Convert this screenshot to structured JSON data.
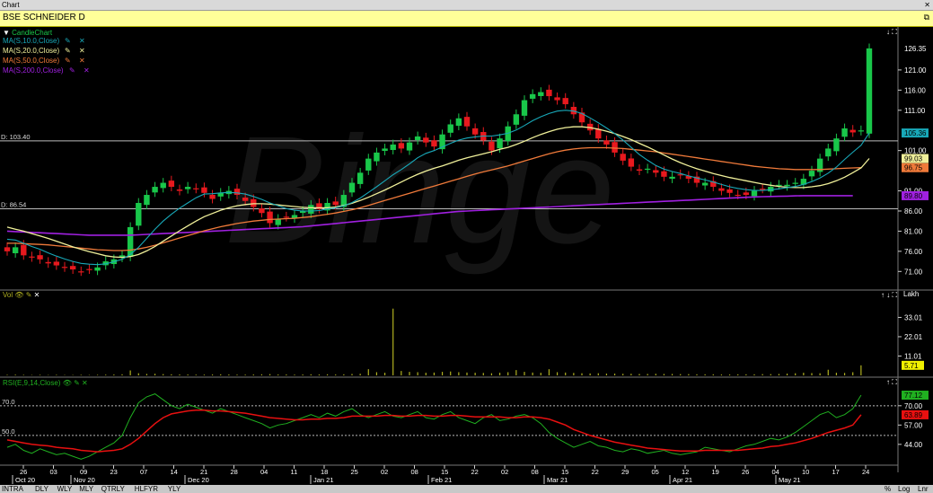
{
  "window": {
    "title": "Chart",
    "close_icon": "close-icon"
  },
  "symbol": {
    "name": "BSE SCHNEIDER D",
    "pin_icon": "pin-icon"
  },
  "colors": {
    "up": "#19c74a",
    "down": "#e8191e",
    "ma10": "#18a8b8",
    "ma20": "#f0f09a",
    "ma50": "#f07a3a",
    "ma200": "#a020e0",
    "volume": "#b0b020",
    "rsi": "#20b020",
    "rsi_avg": "#e81010"
  },
  "legend": {
    "candle": "CandleChart",
    "ma10": "MA(S,10.0,Close)",
    "ma20": "MA(S,20.0,Close)",
    "ma50": "MA(S,50.0,Close)",
    "ma200": "MA(S,200.0,Close)"
  },
  "ref_lines": [
    {
      "label": "D: 103.40",
      "value": 103.4
    },
    {
      "label": "D: 86.54",
      "value": 86.54
    }
  ],
  "price_ticks": [
    "126.35",
    "121.00",
    "116.00",
    "111.00",
    "105.36",
    "101.00",
    "99.03",
    "96.75",
    "91.00",
    "89.80",
    "86.00",
    "81.00",
    "76.00",
    "71.00"
  ],
  "price_badges": [
    {
      "text": "126.35",
      "value": 126.35,
      "bg": "#000000",
      "fg": "#ffffff"
    },
    {
      "text": "105.36",
      "value": 105.36,
      "bg": "#18a8b8",
      "fg": "#000000"
    },
    {
      "text": "99.03",
      "value": 99.03,
      "bg": "#f0f09a",
      "fg": "#000000"
    },
    {
      "text": "96.75",
      "value": 96.75,
      "bg": "#f07a3a",
      "fg": "#000000"
    },
    {
      "text": "89.80",
      "value": 89.8,
      "bg": "#a020e0",
      "fg": "#000000"
    }
  ],
  "volume_panel": {
    "label": "Vol",
    "unit": "Lakh",
    "ticks": [
      "33.01",
      "22.01",
      "11.01"
    ],
    "last": "5.71"
  },
  "rsi_panel": {
    "label": "RSI(E,9,14,Close)",
    "ticks": [
      "70.00",
      "57.00",
      "44.00"
    ],
    "left_ticks": [
      "70.0",
      "50.0"
    ],
    "last": "77.12",
    "avg": "63.89"
  },
  "x_labels": [
    "26",
    "03",
    "09",
    "23",
    "07",
    "14",
    "21",
    "28",
    "04",
    "11",
    "18",
    "25",
    "02",
    "08",
    "15",
    "22",
    "02",
    "08",
    "15",
    "22",
    "29",
    "05",
    "12",
    "19",
    "26",
    "04",
    "10",
    "17",
    "24"
  ],
  "x_months": [
    "Oct 20",
    "Nov 20",
    "Dec 20",
    "Jan 21",
    "Feb 21",
    "Mar 21",
    "Apr 21",
    "May 21"
  ],
  "bottom_tabs": [
    "INTRA",
    "DLY",
    "WLY",
    "MLY",
    "QTRLY",
    "HLFYR",
    "YLY"
  ],
  "bottom_right": [
    "%",
    "Log",
    "Lnr"
  ],
  "watermark": "Binge",
  "chart_data": {
    "type": "candlestick",
    "title": "BSE SCHNEIDER D",
    "y_range": [
      67.5,
      129
    ],
    "closes": [
      76,
      77,
      75,
      74.5,
      74,
      73,
      72.5,
      72,
      71.5,
      71,
      71.5,
      72,
      73.5,
      74,
      75,
      82,
      88,
      90,
      92,
      93,
      92,
      91,
      92,
      91.5,
      90.5,
      89,
      90.5,
      91,
      90,
      88.5,
      87,
      85.5,
      83,
      84,
      84.5,
      85,
      86,
      87.5,
      86.5,
      88,
      87.5,
      90,
      93,
      95.5,
      99,
      100.5,
      101.5,
      102.5,
      101.5,
      103,
      104.5,
      103,
      102,
      105,
      107.5,
      109,
      107,
      105,
      103.5,
      101,
      104,
      107,
      110,
      113.5,
      115,
      115.5,
      114.5,
      113.5,
      112.5,
      110,
      108,
      106,
      104,
      102.5,
      100.5,
      98.5,
      97,
      96,
      96.5,
      95.5,
      94.5,
      94.5,
      95,
      94,
      93,
      93,
      92,
      91,
      90.5,
      90,
      90,
      91,
      91.5,
      92,
      92.5,
      92.5,
      93,
      94,
      96,
      99,
      101.5,
      104,
      106.5,
      105.5,
      106,
      126.35
    ],
    "ma10": [
      79,
      78.8,
      78,
      77.2,
      76.5,
      75.6,
      74.8,
      74.1,
      73.5,
      73,
      72.8,
      72.7,
      72.9,
      73.4,
      74,
      75.2,
      77,
      79.2,
      81.5,
      83.5,
      85.2,
      86.7,
      88,
      89.3,
      90.2,
      90.3,
      90.5,
      90.6,
      90.5,
      90.2,
      89.6,
      88.9,
      88,
      87.3,
      86.6,
      86.2,
      86,
      86,
      86.1,
      86.5,
      86.8,
      87.3,
      88.1,
      89.2,
      90.6,
      92,
      93.5,
      95,
      96.3,
      97.7,
      99.2,
      100.3,
      101,
      101.9,
      102.8,
      103.6,
      104.1,
      104.4,
      104.6,
      104.6,
      104.9,
      105.3,
      106.1,
      107.2,
      108.4,
      109.4,
      110.2,
      110.8,
      111,
      110.8,
      110.2,
      109.1,
      107.9,
      106.6,
      105.2,
      103.6,
      101.8,
      100,
      98.6,
      97.3,
      96.4,
      95.8,
      95.3,
      94.7,
      94.2,
      93.7,
      93.2,
      92.6,
      92,
      91.6,
      91.3,
      91.1,
      91.1,
      91.3,
      91.5,
      91.8,
      92.1,
      92.6,
      93.3,
      94.2,
      95.4,
      96.9,
      98.8,
      100.6,
      102.3,
      105.36
    ],
    "ma20": [
      82,
      81.5,
      81,
      80.4,
      79.8,
      79.2,
      78.5,
      77.8,
      77.1,
      76.5,
      75.9,
      75.4,
      74.9,
      74.6,
      74.5,
      74.7,
      75.2,
      76.1,
      77.2,
      78.5,
      79.8,
      81.1,
      82.3,
      83.5,
      84.6,
      85.4,
      86.2,
      86.8,
      87.3,
      87.6,
      87.8,
      87.8,
      87.7,
      87.5,
      87.3,
      87.1,
      86.9,
      86.8,
      86.8,
      86.8,
      87,
      87.4,
      87.9,
      88.6,
      89.4,
      90.3,
      91.2,
      92.2,
      93.2,
      94.2,
      95.1,
      95.9,
      96.6,
      97.2,
      97.9,
      98.6,
      99.2,
      99.7,
      100.2,
      100.7,
      101.3,
      101.8,
      102.5,
      103.3,
      104.2,
      105,
      105.7,
      106.3,
      106.7,
      106.9,
      106.9,
      106.7,
      106.3,
      105.8,
      105.2,
      104.5,
      103.7,
      102.8,
      101.9,
      100.9,
      99.9,
      98.9,
      98,
      97.2,
      96.5,
      95.9,
      95.3,
      94.8,
      94.3,
      93.9,
      93.5,
      93.1,
      92.7,
      92.4,
      92.1,
      91.9,
      91.8,
      91.8,
      92,
      92.3,
      92.8,
      93.5,
      94.4,
      95.5,
      96.7,
      99.03
    ],
    "ma50": [
      78,
      78,
      77.9,
      77.8,
      77.7,
      77.6,
      77.4,
      77.2,
      77,
      76.8,
      76.6,
      76.4,
      76.3,
      76.2,
      76.2,
      76.3,
      76.6,
      77,
      77.5,
      78.1,
      78.7,
      79.3,
      79.9,
      80.5,
      81.1,
      81.6,
      82.1,
      82.5,
      82.9,
      83.2,
      83.5,
      83.7,
      83.9,
      84,
      84.1,
      84.2,
      84.4,
      84.6,
      84.9,
      85.2,
      85.5,
      85.9,
      86.3,
      86.8,
      87.4,
      88,
      88.6,
      89.2,
      89.8,
      90.4,
      91,
      91.6,
      92.2,
      92.8,
      93.4,
      94,
      94.6,
      95.2,
      95.7,
      96.2,
      96.7,
      97.2,
      97.8,
      98.4,
      99,
      99.6,
      100.2,
      100.7,
      101.1,
      101.4,
      101.6,
      101.7,
      101.7,
      101.7,
      101.6,
      101.5,
      101.3,
      101.1,
      100.9,
      100.7,
      100.4,
      100.1,
      99.8,
      99.5,
      99.2,
      98.9,
      98.6,
      98.3,
      98,
      97.7,
      97.4,
      97.1,
      96.9,
      96.7,
      96.5,
      96.4,
      96.3,
      96.3,
      96.3,
      96.3,
      96.4,
      96.5,
      96.6,
      96.7,
      96.75
    ],
    "ma200": [
      81,
      80.9,
      80.8,
      80.7,
      80.6,
      80.5,
      80.4,
      80.3,
      80.2,
      80.1,
      80,
      80,
      80,
      80,
      80,
      80,
      80.1,
      80.2,
      80.3,
      80.4,
      80.5,
      80.6,
      80.7,
      80.8,
      80.9,
      81,
      81.1,
      81.2,
      81.3,
      81.4,
      81.5,
      81.6,
      81.7,
      81.8,
      81.9,
      82,
      82.1,
      82.3,
      82.5,
      82.7,
      82.9,
      83.1,
      83.3,
      83.5,
      83.7,
      83.9,
      84.1,
      84.3,
      84.5,
      84.7,
      84.9,
      85.1,
      85.3,
      85.5,
      85.7,
      85.9,
      86,
      86.1,
      86.2,
      86.3,
      86.4,
      86.5,
      86.6,
      86.7,
      86.8,
      86.9,
      87,
      87.1,
      87.2,
      87.3,
      87.4,
      87.5,
      87.6,
      87.7,
      87.8,
      87.9,
      88,
      88.1,
      88.2,
      88.3,
      88.4,
      88.5,
      88.6,
      88.7,
      88.8,
      88.9,
      89,
      89.1,
      89.2,
      89.3,
      89.4,
      89.5,
      89.55,
      89.6,
      89.65,
      89.7,
      89.75,
      89.8,
      89.8,
      89.8,
      89.8,
      89.8,
      89.8,
      89.8
    ],
    "volume": [
      0.3,
      0.4,
      0.3,
      0.2,
      0.3,
      0.2,
      0.3,
      0.2,
      0.2,
      0.3,
      0.2,
      0.3,
      0.4,
      0.5,
      0.6,
      2.8,
      1.2,
      0.8,
      0.9,
      0.7,
      0.6,
      0.5,
      0.5,
      0.4,
      0.4,
      0.5,
      0.6,
      0.5,
      0.4,
      0.4,
      0.5,
      0.6,
      0.7,
      0.5,
      0.5,
      0.4,
      0.5,
      0.6,
      0.5,
      0.6,
      0.5,
      0.6,
      0.8,
      0.9,
      3.5,
      1.8,
      1.5,
      38,
      2.5,
      2,
      1.8,
      1.5,
      1.6,
      2,
      2.2,
      1.8,
      1.6,
      1.5,
      1.4,
      1.2,
      1.5,
      1.8,
      3,
      2,
      1.6,
      1.5,
      3.5,
      1.8,
      1.6,
      1.4,
      1.2,
      1.1,
      1.2,
      1,
      1,
      0.9,
      0.9,
      0.8,
      0.8,
      0.9,
      0.8,
      0.8,
      0.7,
      0.7,
      0.6,
      0.6,
      0.6,
      0.5,
      0.5,
      0.6,
      0.6,
      0.6,
      0.7,
      0.7,
      0.8,
      1,
      1.2,
      1.5,
      1.3,
      1.2,
      3.2,
      1.5,
      1.4,
      1.8,
      5.71
    ],
    "rsi": [
      42,
      44,
      40,
      38,
      41,
      39,
      37,
      38,
      36,
      34,
      36,
      39,
      42,
      45,
      50,
      62,
      72,
      76,
      78,
      74,
      70,
      68,
      71,
      69,
      67,
      65,
      68,
      66,
      64,
      62,
      60,
      58,
      55,
      57,
      58,
      60,
      62,
      64,
      62,
      65,
      63,
      66,
      68,
      64,
      62,
      64,
      66,
      63,
      62,
      64,
      66,
      62,
      61,
      64,
      66,
      62,
      60,
      58,
      62,
      64,
      60,
      61,
      63,
      64,
      62,
      58,
      52,
      48,
      45,
      42,
      44,
      46,
      43,
      42,
      40,
      39,
      41,
      40,
      38,
      39,
      40,
      38,
      37,
      38,
      39,
      42,
      41,
      40,
      39,
      41,
      43,
      44,
      46,
      48,
      47,
      49,
      52,
      56,
      60,
      64,
      66,
      62,
      64,
      68,
      77.12
    ],
    "rsi_avg": [
      47,
      46,
      45,
      44,
      43.5,
      43,
      42,
      41.5,
      41,
      40,
      39.5,
      39,
      39.5,
      40,
      41,
      44,
      48,
      53,
      58,
      62,
      64.5,
      65.5,
      66.5,
      67,
      67,
      66.5,
      66.5,
      66,
      65.5,
      65,
      64,
      63,
      62,
      61.5,
      61,
      60.5,
      60.5,
      61,
      61,
      61.5,
      61.5,
      62,
      63,
      63,
      63,
      63,
      63.5,
      63.5,
      63,
      63,
      63.5,
      63.5,
      63,
      63,
      63.5,
      63.5,
      63,
      62.5,
      62.5,
      62.5,
      62.5,
      62,
      62,
      62.5,
      62.5,
      62,
      61,
      59,
      57,
      54,
      52,
      50,
      48.5,
      47,
      45.5,
      44.5,
      43.5,
      42.5,
      41.5,
      41,
      40.5,
      40,
      39.5,
      39.5,
      39.5,
      40,
      40,
      40,
      40,
      40,
      40.5,
      41,
      41.5,
      42.5,
      43,
      44,
      45,
      46.5,
      48,
      50,
      52,
      53.5,
      55,
      57,
      63.89
    ]
  }
}
